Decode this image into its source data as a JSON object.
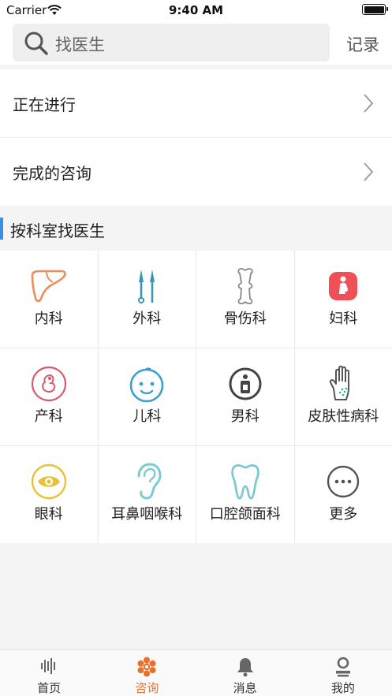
{
  "status_bar": {
    "carrier": "Carrier",
    "time": "9:40 AM"
  },
  "header": {
    "search_placeholder": "找医生",
    "record_label": "记录"
  },
  "rows": [
    {
      "label": "正在进行"
    },
    {
      "label": "完成的咨询"
    }
  ],
  "section": {
    "title": "按科室找医生"
  },
  "departments": [
    {
      "label": "内科",
      "icon": "liver-icon"
    },
    {
      "label": "外科",
      "icon": "scalpel-icon"
    },
    {
      "label": "骨伤科",
      "icon": "bone-icon"
    },
    {
      "label": "妇科",
      "icon": "pregnant-woman-icon"
    },
    {
      "label": "产科",
      "icon": "fetus-icon"
    },
    {
      "label": "儿科",
      "icon": "baby-face-icon"
    },
    {
      "label": "男科",
      "icon": "male-icon"
    },
    {
      "label": "皮肤性病科",
      "icon": "hand-skin-icon"
    },
    {
      "label": "眼科",
      "icon": "eye-icon"
    },
    {
      "label": "耳鼻咽喉科",
      "icon": "ear-icon"
    },
    {
      "label": "口腔颌面科",
      "icon": "tooth-icon"
    },
    {
      "label": "更多",
      "icon": "more-icon"
    }
  ],
  "tabbar": {
    "active_index": 1,
    "items": [
      {
        "label": "首页",
        "icon": "waveform-icon"
      },
      {
        "label": "咨询",
        "icon": "hexagon-cluster-icon"
      },
      {
        "label": "消息",
        "icon": "bell-icon"
      },
      {
        "label": "我的",
        "icon": "person-icon"
      }
    ]
  },
  "colors": {
    "accent": "#e8702a",
    "section_bar": "#3a8ee6"
  }
}
